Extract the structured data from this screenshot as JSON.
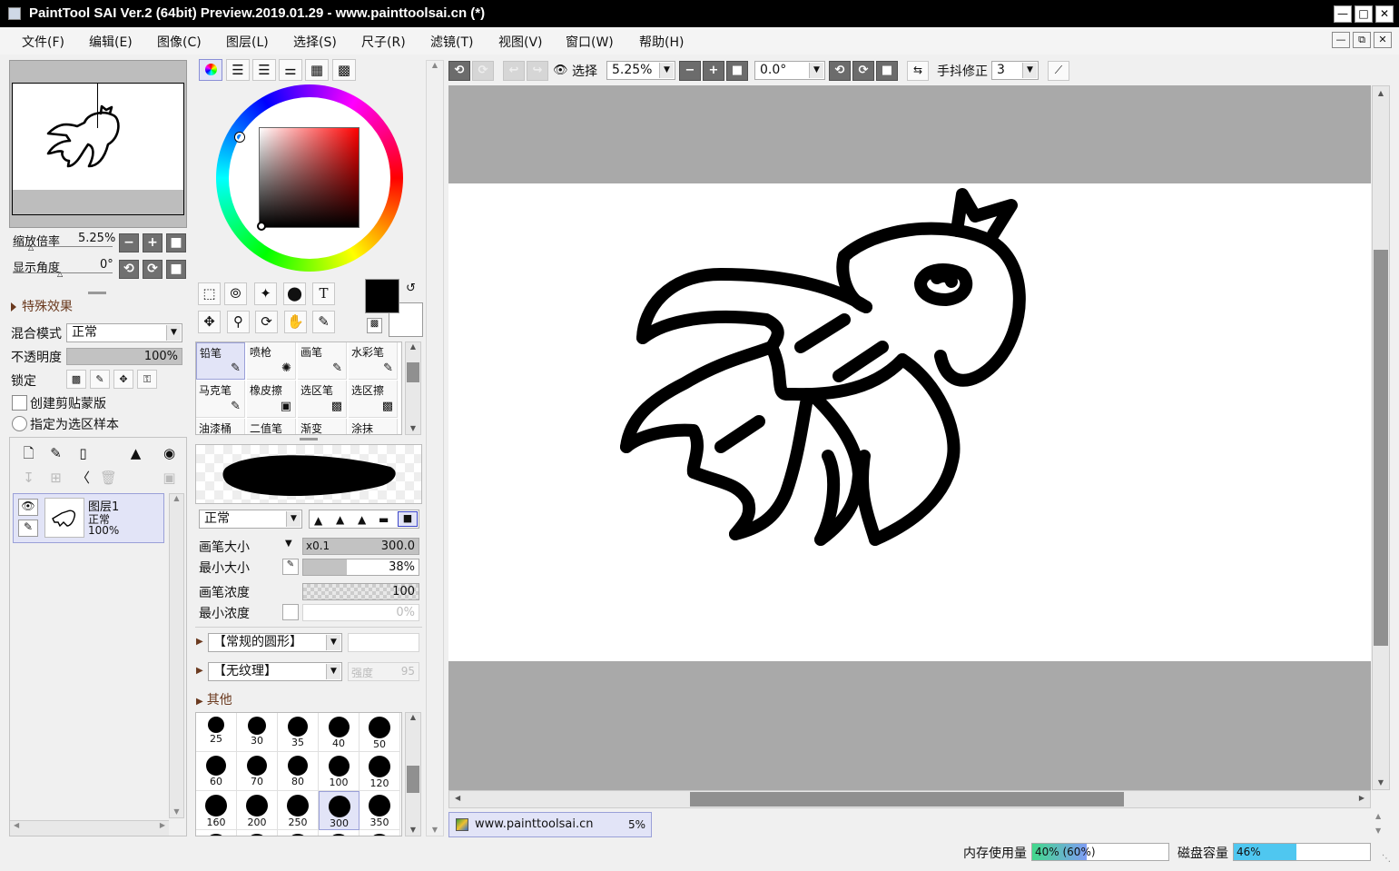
{
  "window": {
    "title": "PaintTool SAI Ver.2 (64bit) Preview.2019.01.29 - www.painttoolsai.cn (*)",
    "min_icon": "minimize-icon",
    "max_icon": "maximize-icon",
    "close_icon": "close-icon"
  },
  "menu": [
    "文件(F)",
    "编辑(E)",
    "图像(C)",
    "图层(L)",
    "选择(S)",
    "尺子(R)",
    "滤镜(T)",
    "视图(V)",
    "窗口(W)",
    "帮助(H)"
  ],
  "navigator": {
    "zoom_label": "缩放倍率",
    "zoom_value": "5.25%",
    "angle_label": "显示角度",
    "angle_value": "0°"
  },
  "effects": {
    "title": "特殊效果"
  },
  "layer_props": {
    "blend_label": "混合模式",
    "blend_value": "正常",
    "opacity_label": "不透明度",
    "opacity_value": "100%",
    "lock_label": "锁定",
    "clip_label": "创建剪贴蒙版",
    "sample_label": "指定为选区样本"
  },
  "layers": [
    {
      "name": "图层1",
      "mode": "正常",
      "opacity": "100%"
    }
  ],
  "brushes": [
    {
      "label": "铅笔",
      "selected": true
    },
    {
      "label": "喷枪"
    },
    {
      "label": "画笔"
    },
    {
      "label": "水彩笔"
    },
    {
      "label": "马克笔"
    },
    {
      "label": "橡皮擦"
    },
    {
      "label": "选区笔"
    },
    {
      "label": "选区擦"
    },
    {
      "label": "油漆桶"
    },
    {
      "label": "二值笔"
    },
    {
      "label": "渐变"
    },
    {
      "label": "涂抹"
    }
  ],
  "brush_settings": {
    "blend_value": "正常",
    "size_label": "画笔大小",
    "size_mult": "x0.1",
    "size_value": "300.0",
    "min_size_label": "最小大小",
    "min_size_value": "38%",
    "min_size_fraction": 0.38,
    "density_label": "画笔浓度",
    "density_value": "100",
    "min_density_label": "最小浓度",
    "min_density_value": "0%",
    "shape_value": "【常规的圆形】",
    "texture_value": "【无纹理】",
    "texture_strength_label": "强度",
    "texture_strength_value": "95",
    "other_label": "其他"
  },
  "brush_sizes": [
    "25",
    "30",
    "35",
    "40",
    "50",
    "60",
    "70",
    "80",
    "100",
    "120",
    "160",
    "200",
    "250",
    "300",
    "350"
  ],
  "selected_size": "300",
  "toolbar": {
    "select_label": "选择",
    "zoom_value": "5.25%",
    "angle_value": "0.0°",
    "stabilizer_label": "手抖修正",
    "stabilizer_value": "3"
  },
  "document_tab": {
    "name": "www.painttoolsai.cn",
    "zoom": "5%"
  },
  "status": {
    "memory_label": "内存使用量",
    "memory_value": "40% (60%)",
    "memory_fraction": 0.4,
    "disk_label": "磁盘容量",
    "disk_value": "46%",
    "disk_fraction": 0.46
  },
  "colors": {
    "primary": "#000000",
    "secondary": "#ffffff",
    "selection_bg": "#e2e4f7",
    "memory_bar": "#7f9cf5",
    "disk_bar": "#4fc7f0"
  }
}
